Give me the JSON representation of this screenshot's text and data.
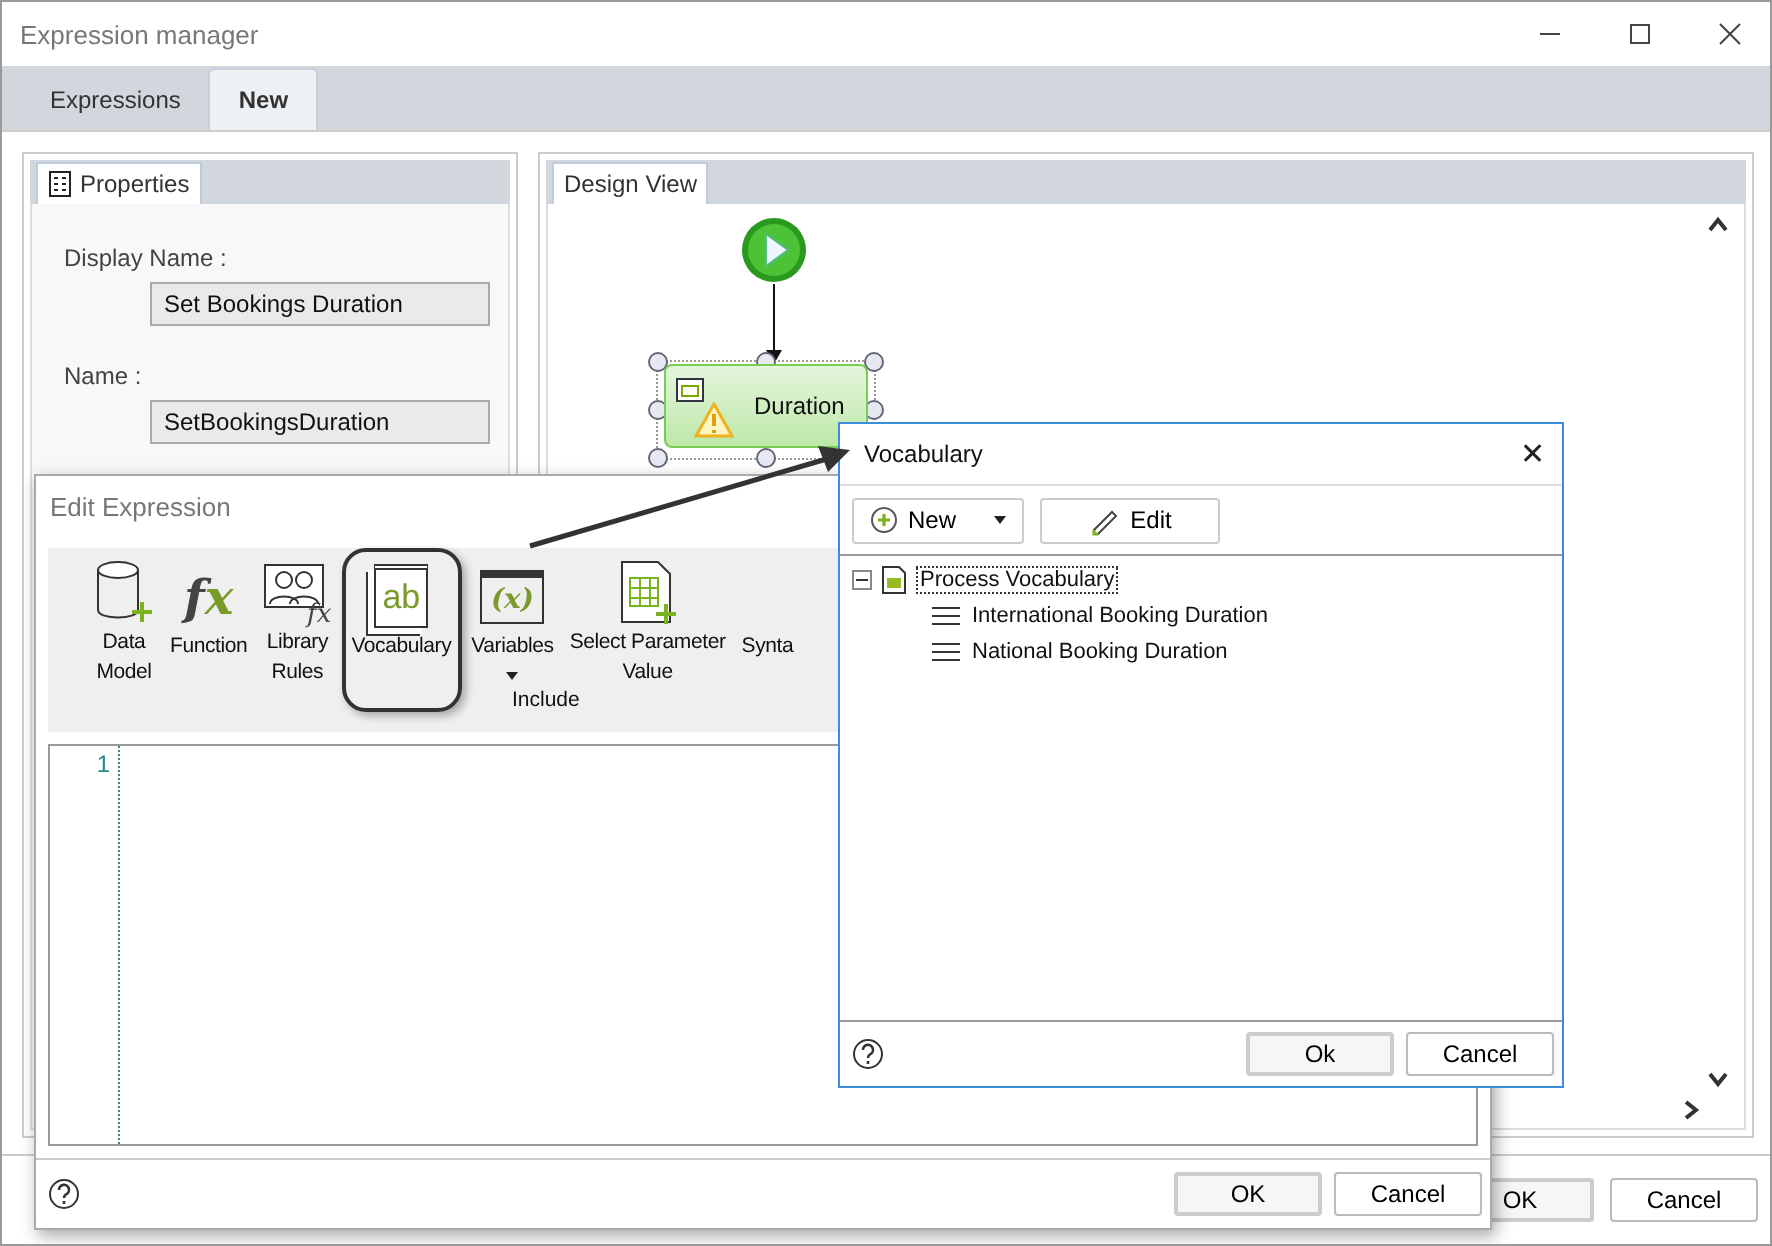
{
  "window": {
    "title": "Expression manager"
  },
  "tabs": [
    {
      "label": "Expressions",
      "selected": false
    },
    {
      "label": "New",
      "selected": true
    }
  ],
  "properties_panel": {
    "tab": "Properties",
    "fields": [
      {
        "label": "Display Name :",
        "value": "Set Bookings Duration"
      },
      {
        "label": "Name :",
        "value": "SetBookingsDuration"
      }
    ]
  },
  "design_view": {
    "tab": "Design View",
    "node": {
      "label": "Duration",
      "warning": true,
      "selected": true
    }
  },
  "buttons": [
    "OK",
    "Cancel"
  ],
  "edit_expression": {
    "title": "Edit Expression",
    "toolbar": [
      {
        "kind": "database",
        "lines": [
          "Data",
          "Model"
        ],
        "highlighted": false
      },
      {
        "kind": "function",
        "glyph": "fx",
        "lines": [
          "Function"
        ],
        "highlighted": false
      },
      {
        "kind": "library",
        "glyph": "fx",
        "lines": [
          "Library",
          "Rules"
        ],
        "highlighted": false
      },
      {
        "kind": "vocabulary",
        "glyph": "ab",
        "lines": [
          "Vocabulary"
        ],
        "highlighted": true
      },
      {
        "kind": "variables",
        "glyph": "(x)",
        "lines": [
          "Variables"
        ],
        "dropdown": true,
        "highlighted": false
      },
      {
        "kind": "parameter",
        "lines": [
          "Select Parameter",
          "Value"
        ],
        "highlighted": false
      },
      {
        "kind": "plain",
        "lines": [
          "Synta"
        ],
        "highlighted": false
      }
    ],
    "group_label": "Include",
    "line_numbers": [
      "1"
    ],
    "buttons": [
      "OK",
      "Cancel"
    ]
  },
  "vocabulary": {
    "title": "Vocabulary",
    "close": "✕",
    "toolbar": [
      {
        "kind": "new",
        "label": "New",
        "dropdown": true
      },
      {
        "kind": "edit",
        "label": "Edit"
      }
    ],
    "tree": [
      {
        "label": "Process Vocabulary",
        "expanded": true,
        "selected": true,
        "children": [
          {
            "label": "International Booking Duration",
            "selected": false
          },
          {
            "label": "National Booking Duration",
            "selected": false
          }
        ]
      }
    ],
    "buttons": [
      "Ok",
      "Cancel"
    ]
  }
}
